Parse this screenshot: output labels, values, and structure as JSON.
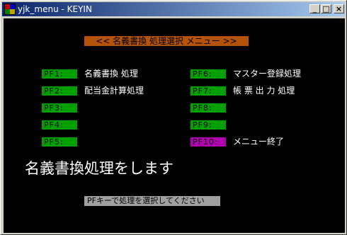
{
  "window": {
    "title": "yjk_menu - KEYIN",
    "app_icon": "app-icon",
    "controls": {
      "minimize": "_",
      "maximize": "□",
      "close": "×"
    }
  },
  "header": {
    "label": "<<  名義書換 処理選択 メニュー  >>"
  },
  "menu": {
    "left": [
      {
        "key": "PF1:",
        "label": "名義書換  処理"
      },
      {
        "key": "PF2:",
        "label": "配当金計算処理"
      },
      {
        "key": "PF3:",
        "label": ""
      },
      {
        "key": "PF4:",
        "label": ""
      },
      {
        "key": "PF5:",
        "label": ""
      }
    ],
    "right": [
      {
        "key": "PF6:",
        "label": "マスター登録処理"
      },
      {
        "key": "PF7:",
        "label": "帳 票 出 力 処理"
      },
      {
        "key": "PF8:",
        "label": ""
      },
      {
        "key": "PF9:",
        "label": ""
      },
      {
        "key": "PF10:",
        "label": "メニュー終了"
      }
    ]
  },
  "message": "名義書換処理をします",
  "status": "PFキーで処理を選択してください",
  "colors": {
    "background": "#000000",
    "header_bg": "#b45309",
    "key_bg": "#00a000",
    "exit_key_bg": "#b000b0",
    "status_bg": "#a0a0a0",
    "titlebar_start": "#0a246a",
    "titlebar_end": "#a6caf0"
  }
}
